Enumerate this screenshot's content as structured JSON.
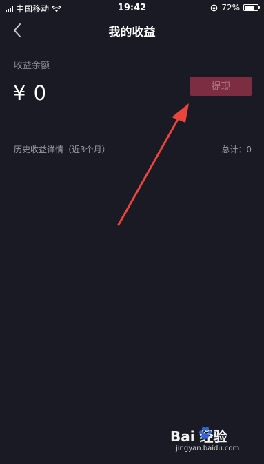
{
  "status_bar": {
    "carrier": "中国移动",
    "time": "19:42",
    "battery_percent": "72%",
    "battery_level": 0.72,
    "icons": [
      "signal-icon",
      "wifi-icon",
      "rotation-lock-icon",
      "battery-icon"
    ]
  },
  "nav": {
    "title": "我的收益",
    "back_icon": "chevron-left-icon"
  },
  "balance": {
    "label": "收益余额",
    "amount": "¥ 0",
    "withdraw_label": "提现"
  },
  "history": {
    "label": "历史收益详情（近3个月）",
    "total": "总计：0"
  },
  "watermark": {
    "logo": "Bai  经验",
    "url": "jingyan.baidu.com"
  },
  "colors": {
    "background": "#1a1a24",
    "withdraw_button": "#7d2d41",
    "withdraw_text": "#b07686",
    "annotation_arrow": "#e8453c",
    "muted_text": "#8a8a94"
  }
}
